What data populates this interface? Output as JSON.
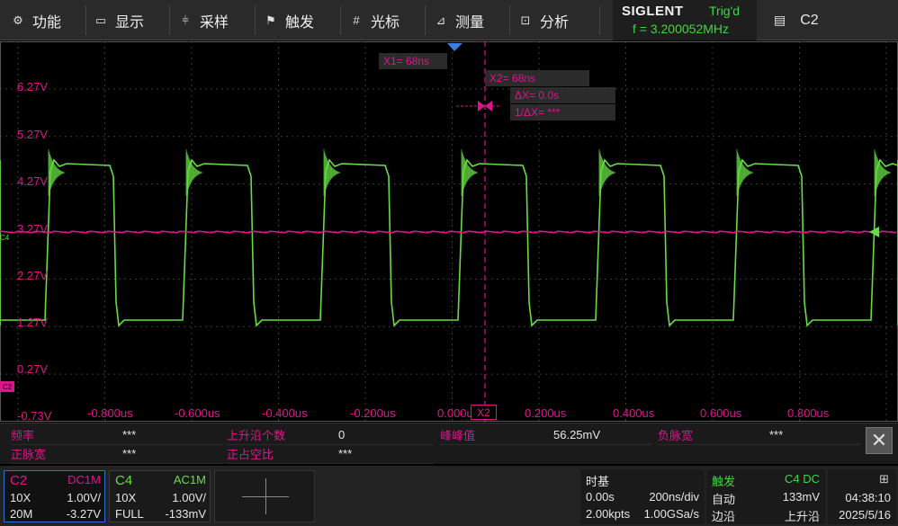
{
  "menu": {
    "items": [
      {
        "label": "功能",
        "icon": "gear-icon"
      },
      {
        "label": "显示",
        "icon": "display-icon"
      },
      {
        "label": "采样",
        "icon": "sampling-icon"
      },
      {
        "label": "触发",
        "icon": "trigger-flag-icon"
      },
      {
        "label": "光标",
        "icon": "cursor-grid-icon"
      },
      {
        "label": "测量",
        "icon": "measure-icon"
      },
      {
        "label": "分析",
        "icon": "analysis-icon"
      }
    ],
    "brand": "SIGLENT",
    "trig_status": "Trig'd",
    "frequency": "f = 3.200052MHz",
    "active_channel": "C2",
    "active_channel_icon": "channel-list-icon"
  },
  "grid": {
    "y_labels": [
      "6.27V",
      "5.27V",
      "4.27V",
      "3.27V",
      "2.27V",
      "1.27V",
      "0.27V",
      "-0.73V"
    ],
    "x_labels": [
      "-0.800us",
      "-0.600us",
      "-0.400us",
      "-0.200us",
      "0.000us",
      "0.200us",
      "0.400us",
      "0.600us",
      "0.800us"
    ],
    "c4_marker": "C4",
    "c2_marker": "C2"
  },
  "cursors": {
    "x1": "X1= 68ns",
    "x2": "X2= 68ns",
    "delta": "ΔX= 0.0s",
    "inv_delta": "1/ΔX= ***",
    "x2_tag": "X2"
  },
  "measurements": {
    "row1": [
      {
        "name": "频率",
        "value": "***"
      },
      {
        "name": "上升沿个数",
        "value": "0"
      },
      {
        "name": "峰峰值",
        "value": "56.25mV"
      },
      {
        "name": "负脉宽",
        "value": "***"
      }
    ],
    "row2": [
      {
        "name": "正脉宽",
        "value": "***"
      },
      {
        "name": "正占空比",
        "value": "***"
      }
    ]
  },
  "channels": {
    "c2": {
      "name": "C2",
      "coupling": "DC1M",
      "probe": "10X",
      "scale": "1.00V/",
      "bw": "20M",
      "offset": "-3.27V"
    },
    "c4": {
      "name": "C4",
      "coupling": "AC1M",
      "probe": "10X",
      "scale": "1.00V/",
      "bw": "FULL",
      "offset": "-133mV"
    }
  },
  "timebase": {
    "title": "时基",
    "delay": "0.00s",
    "scale": "200ns/div",
    "points": "2.00kpts",
    "rate": "1.00GSa/s"
  },
  "trigger": {
    "title": "触发",
    "source": "C4 DC",
    "mode": "自动",
    "level": "133mV",
    "type": "边沿",
    "slope": "上升沿"
  },
  "clock": {
    "time": "04:38:10",
    "date": "2025/5/16",
    "icon": "network-icon"
  },
  "colors": {
    "c2": "#e0138c",
    "c4": "#66dd44",
    "trig": "#43d443",
    "accent": "#2a6fd6"
  }
}
